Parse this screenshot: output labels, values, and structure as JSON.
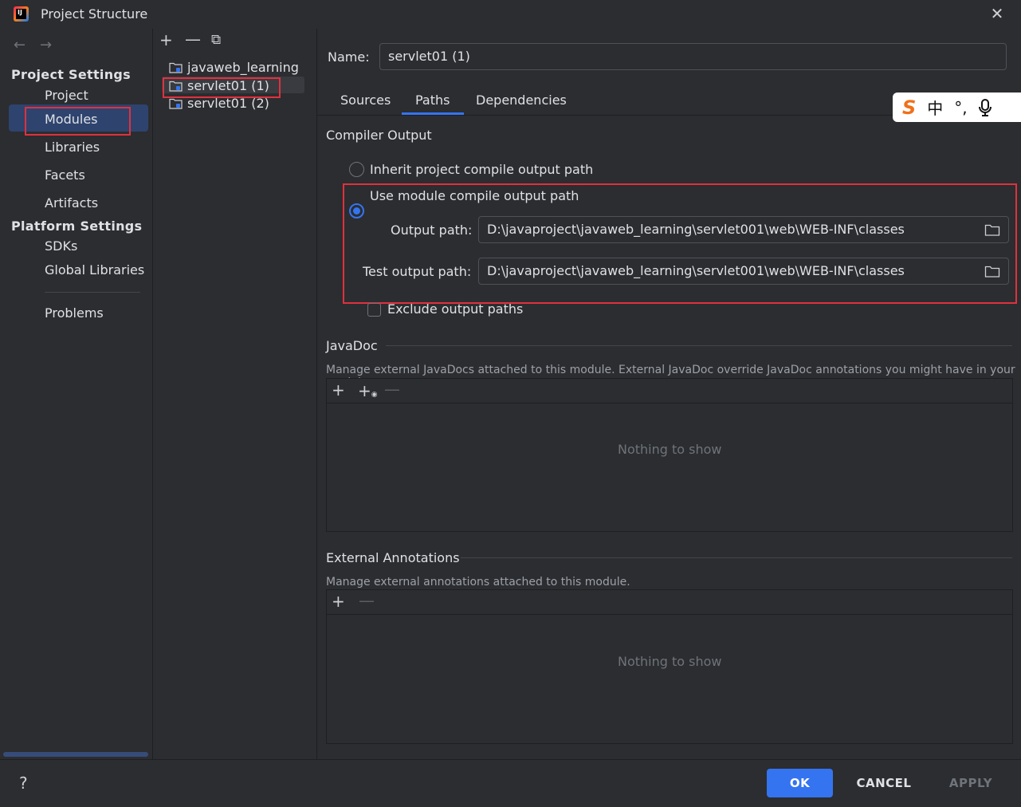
{
  "window": {
    "title": "Project Structure",
    "logo_text": "IJ"
  },
  "nav": {
    "back": "←",
    "forward": "→"
  },
  "left": {
    "project_settings_title": "Project Settings",
    "items": [
      "Project",
      "Modules",
      "Libraries",
      "Facets",
      "Artifacts"
    ],
    "platform_settings_title": "Platform Settings",
    "platform_items": [
      "SDKs",
      "Global Libraries"
    ],
    "problems": "Problems"
  },
  "middle": {
    "toolbar": {
      "add": "+",
      "remove": "—",
      "copy": "⧉"
    },
    "tree": [
      "javaweb_learning",
      "servlet01 (1)",
      "servlet01 (2)"
    ]
  },
  "right": {
    "name_label": "Name:",
    "name_value": "servlet01 (1)",
    "tabs": [
      "Sources",
      "Paths",
      "Dependencies"
    ],
    "active_tab": "Paths",
    "compiler_output": {
      "title": "Compiler Output",
      "inherit_label": "Inherit project compile output path",
      "use_module_label": "Use module compile output path",
      "output_path_label": "Output path:",
      "output_path_value": "D:\\javaproject\\javaweb_learning\\servlet001\\web\\WEB-INF\\classes",
      "test_output_path_label": "Test output path:",
      "test_output_path_value": "D:\\javaproject\\javaweb_learning\\servlet001\\web\\WEB-INF\\classes",
      "exclude_label": "Exclude output paths"
    },
    "javadoc": {
      "title": "JavaDoc",
      "description": "Manage external JavaDocs attached to this module. External JavaDoc override JavaDoc annotations you might have in your module.",
      "empty": "Nothing to show",
      "add": "+",
      "add_url": "+",
      "remove": "—"
    },
    "external_annotations": {
      "title": "External Annotations",
      "description": "Manage external annotations attached to this module.",
      "empty": "Nothing to show",
      "add": "+",
      "remove": "—"
    }
  },
  "ime": {
    "logo": "S",
    "lang": "中",
    "punct": "°,",
    "mic": "🎙"
  },
  "footer": {
    "help": "?",
    "ok": "OK",
    "cancel": "CANCEL",
    "apply": "APPLY"
  },
  "colors": {
    "accent": "#3574f0",
    "highlight_box": "#e0313e",
    "selection": "#2e436e"
  }
}
